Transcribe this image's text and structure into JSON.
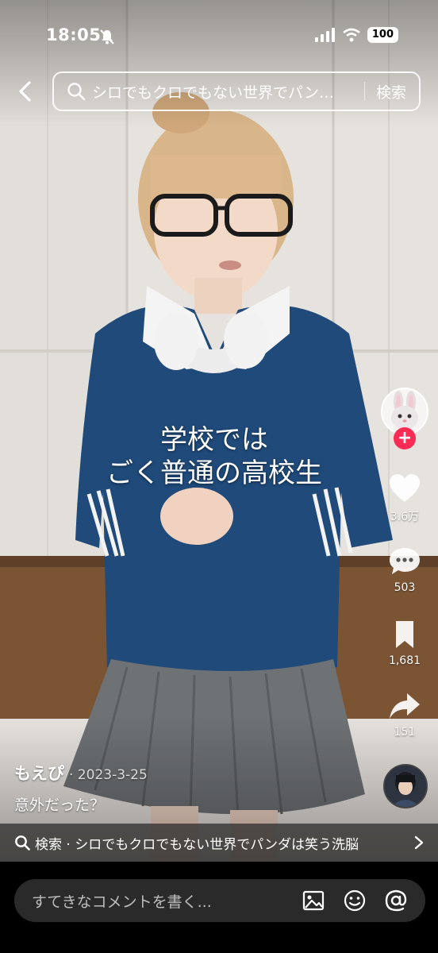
{
  "status_bar": {
    "time": "18:05",
    "battery": "100"
  },
  "search": {
    "query": "シロでもクロでもない世界でパン…",
    "submit_label": "検索"
  },
  "caption": {
    "line1": "学校では",
    "line2": "ごく普通の高校生"
  },
  "actions": {
    "likes": "3.6万",
    "comments": "503",
    "saves": "1,681",
    "shares": "151"
  },
  "author": {
    "name": "もえぴ",
    "date": "· 2023-3-25"
  },
  "description": "意外だった？",
  "related_search": "検索 · シロでもクロでもない世界でパンダは笑う洗脳",
  "comment_bar": {
    "placeholder": "すてきなコメントを書く..."
  },
  "colors": {
    "follow_plus": "#fe2c55",
    "comment_box": "#2a2a2a"
  }
}
